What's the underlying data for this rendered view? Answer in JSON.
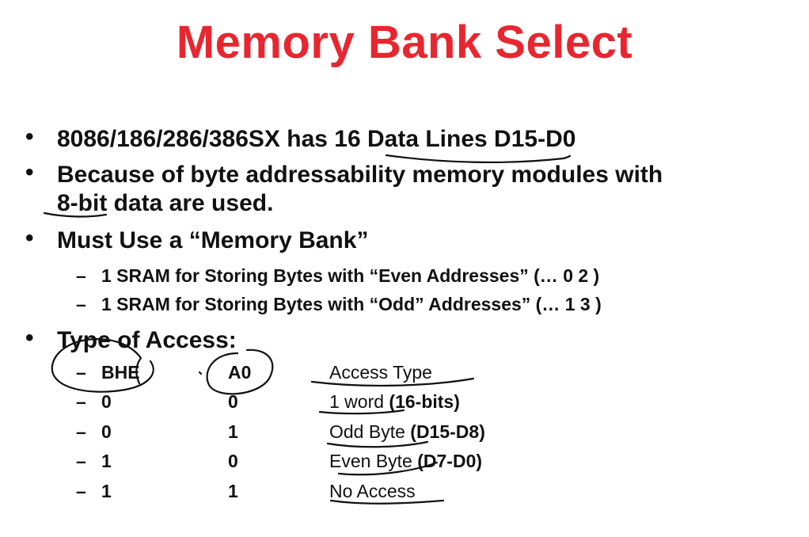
{
  "title": "Memory Bank Select",
  "bullets": [
    {
      "text_a": "8086/186/286/386SX has ",
      "text_b": "16 Data Lines",
      "text_c": " D15-D0"
    },
    {
      "line1": "Because of byte addressability memory modules with",
      "line2_a": "8-bit",
      "line2_b": " data are used."
    },
    {
      "text": "Must Use a “Memory Bank”",
      "sub": [
        "1 SRAM for Storing Bytes with “Even Addresses” (… 0 2 )",
        "1 SRAM for Storing Bytes with “Odd” Addresses” (… 1 3 )"
      ]
    },
    {
      "text": "Type of Access:"
    }
  ],
  "bullet_symbol": "•",
  "dash_symbol": "–",
  "access_table": {
    "headers": {
      "bhe": "BHE",
      "a0": "A0",
      "type": "Access Type"
    },
    "rows": [
      {
        "bhe": "0",
        "a0": "0",
        "type_main": "1 word",
        "type_rest": " (16-bits)"
      },
      {
        "bhe": "0",
        "a0": "1",
        "type_main": "Odd Byte",
        "type_rest": " (D15-D8)"
      },
      {
        "bhe": "1",
        "a0": "0",
        "type_main": "Even Byte",
        "type_rest": " (D7-D0)"
      },
      {
        "bhe": "1",
        "a0": "1",
        "type_main": "No Access",
        "type_rest": ""
      }
    ]
  },
  "colors": {
    "title": "#e8262f",
    "text": "#111111",
    "ink": "#111111"
  }
}
